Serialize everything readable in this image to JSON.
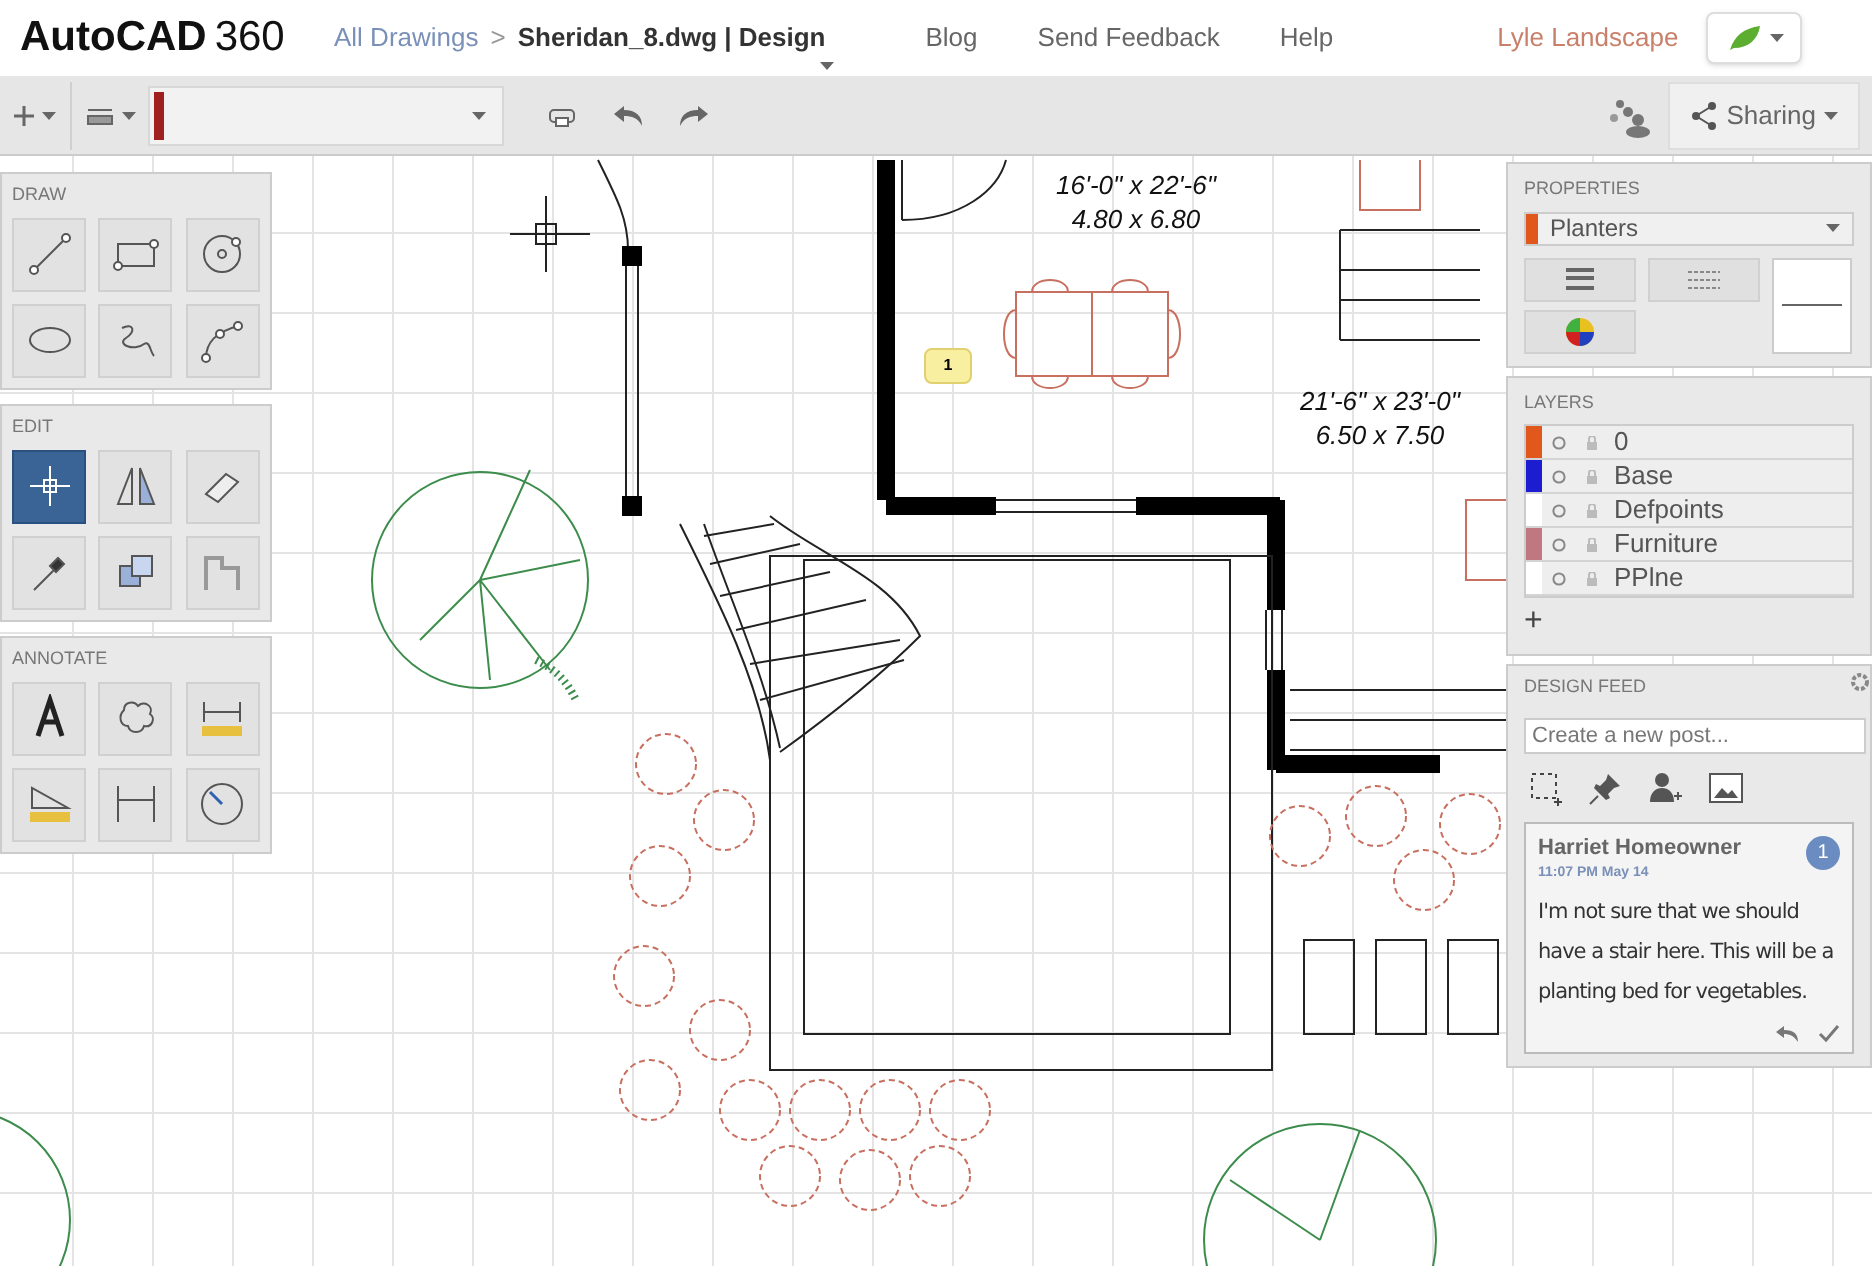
{
  "header": {
    "app_name": "AutoCAD",
    "app_version": "360",
    "breadcrumb": {
      "parent": "All Drawings",
      "separator": ">",
      "current": "Sheridan_8.dwg | Design"
    },
    "nav": [
      "Blog",
      "Send Feedback",
      "Help"
    ],
    "user": "Lyle Landscape"
  },
  "toolbar": {
    "sharing": "Sharing"
  },
  "canvas": {
    "dimension_labels": [
      {
        "line1": "16'-0\" x 22'-6\"",
        "line2": "4.80 x 6.80"
      },
      {
        "line1": "21'-6\" x 23'-0\"",
        "line2": "6.50 x 7.50"
      }
    ],
    "comment_marker": "1"
  },
  "tool_palette": [
    {
      "title": "DRAW",
      "tools": [
        {
          "selected": false
        },
        {
          "selected": false
        },
        {
          "selected": false
        },
        {
          "selected": false
        },
        {
          "selected": false
        },
        {
          "selected": false
        }
      ]
    },
    {
      "title": "EDIT",
      "tools": [
        {
          "selected": true
        },
        {
          "selected": false
        },
        {
          "selected": false
        },
        {
          "selected": false
        },
        {
          "selected": false
        },
        {
          "selected": false
        }
      ]
    },
    {
      "title": "ANNOTATE",
      "tools": [
        {
          "selected": false
        },
        {
          "selected": false
        },
        {
          "selected": false
        },
        {
          "selected": false
        },
        {
          "selected": false
        },
        {
          "selected": false
        }
      ]
    }
  ],
  "properties": {
    "title": "PROPERTIES",
    "layer": "Planters",
    "color": "#e0581c"
  },
  "layers": {
    "title": "LAYERS",
    "items": [
      {
        "name": "0",
        "color": "#e0581c"
      },
      {
        "name": "Base",
        "color": "#1c1cd0"
      },
      {
        "name": "Defpoints",
        "color": "#ffffff"
      },
      {
        "name": "Furniture",
        "color": "#c07880"
      },
      {
        "name": "PPlne",
        "color": "#ffffff"
      }
    ],
    "add": "+"
  },
  "design_feed": {
    "title": "DESIGN FEED",
    "placeholder": "Create a new post...",
    "post": {
      "author": "Harriet Homeowner",
      "time": "11:07 PM May 14",
      "badge": "1",
      "body": "I'm not sure that we should have a stair here. This will be a planting bed for vegetables."
    }
  }
}
